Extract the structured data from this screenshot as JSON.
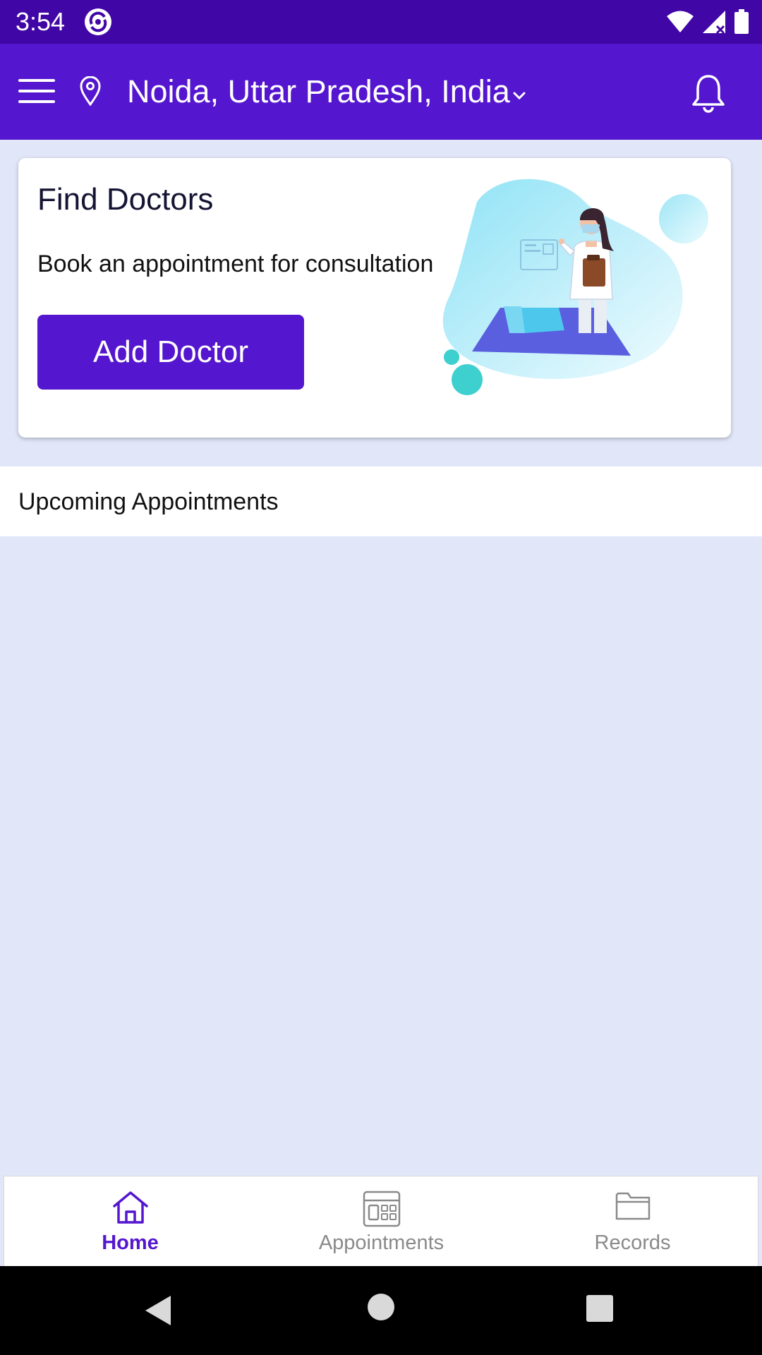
{
  "status_bar": {
    "time": "3:54",
    "icons": [
      "app-notification-icon",
      "wifi-icon",
      "cell-signal-icon",
      "battery-icon"
    ]
  },
  "app_bar": {
    "location": "Noida, Uttar Pradesh, India",
    "icons": [
      "menu-icon",
      "location-pin-icon",
      "chevron-down-icon",
      "notification-bell-icon"
    ],
    "background_color": "#5516cf"
  },
  "find_doctors_card": {
    "title": "Find Doctors",
    "subtitle": "Book an appointment for consultation",
    "button_label": "Add Doctor",
    "illustration": "doctor-illustration"
  },
  "upcoming": {
    "label": "Upcoming Appointments"
  },
  "bottom_nav": {
    "items": [
      {
        "label": "Home",
        "icon": "home-icon",
        "active": true
      },
      {
        "label": "Appointments",
        "icon": "calendar-grid-icon",
        "active": false
      },
      {
        "label": "Records",
        "icon": "folder-icon",
        "active": false
      }
    ],
    "active_color": "#5516cf",
    "inactive_color": "#8a8a8a"
  },
  "system_nav": {
    "icons": [
      "back-icon",
      "home-circle-icon",
      "recents-icon"
    ]
  }
}
